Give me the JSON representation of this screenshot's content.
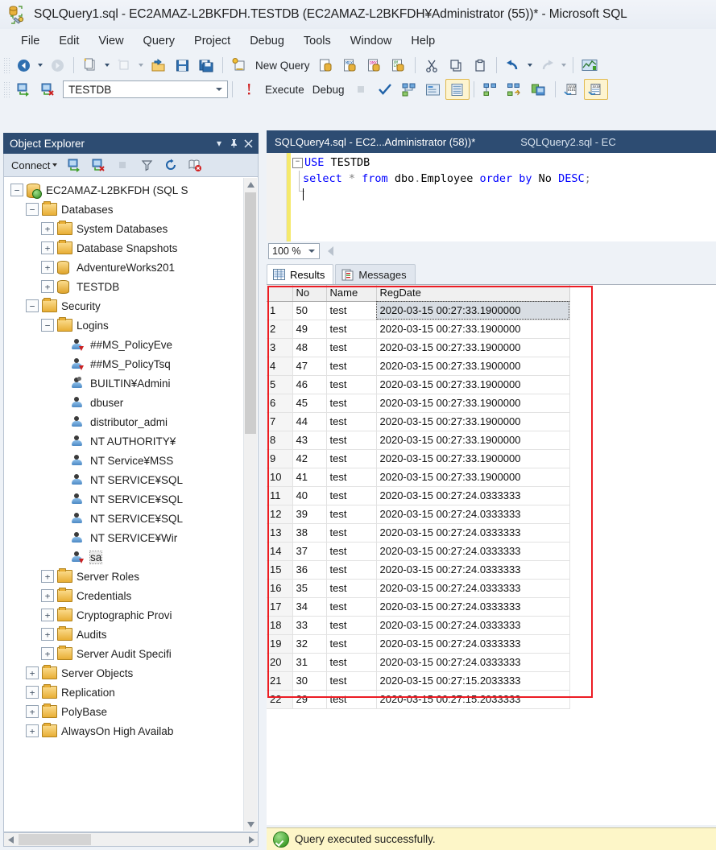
{
  "window": {
    "title": "SQLQuery1.sql - EC2AMAZ-L2BKFDH.TESTDB (EC2AMAZ-L2BKFDH¥Administrator (55))* - Microsoft SQL",
    "icon": "sql-query-file-icon"
  },
  "menu": {
    "items": [
      "File",
      "Edit",
      "View",
      "Query",
      "Project",
      "Debug",
      "Tools",
      "Window",
      "Help"
    ]
  },
  "toolbar_main": {
    "new_query_label": "New Query",
    "icons": [
      "navigate-back-icon",
      "navigate-forward-icon",
      "new-project-icon",
      "new-item-icon",
      "open-file-icon",
      "save-icon",
      "save-all-icon",
      "new-query-icon",
      "new-query-with-current-connection-icon",
      "new-analysis-services-mdx-query-icon",
      "new-analysis-services-dmx-query-icon",
      "new-analysis-services-xmla-query-icon",
      "cut-icon",
      "copy-icon",
      "paste-icon",
      "undo-icon",
      "redo-icon",
      "activity-monitor-icon"
    ]
  },
  "toolbar_query": {
    "database_value": "TESTDB",
    "execute_label": "Execute",
    "debug_label": "Debug",
    "icons": [
      "available-databases-icon",
      "change-connection-icon",
      "disconnect-icon",
      "execute-icon",
      "stop-icon",
      "parse-icon",
      "display-estimated-execution-plan-icon",
      "query-options-icon",
      "results-to-grid-icon",
      "include-actual-execution-plan-icon",
      "include-live-query-statistics-icon",
      "results-to-text-icon",
      "results-to-file-icon",
      "comment-icon",
      "uncomment-icon"
    ]
  },
  "object_explorer": {
    "title": "Object Explorer",
    "connect_label": "Connect",
    "header_icons": [
      "window-position-icon",
      "auto-hide-pin-icon",
      "close-icon"
    ],
    "toolbar_icons": [
      "connect-object-explorer-icon",
      "disconnect-object-explorer-icon",
      "stop-icon",
      "filter-icon",
      "refresh-icon",
      "script-error-icon"
    ],
    "tree": [
      {
        "label": "EC2AMAZ-L2BKFDH (SQL S",
        "indent": 0,
        "expander": "minus",
        "icon": "server-icon"
      },
      {
        "label": "Databases",
        "indent": 1,
        "expander": "minus",
        "icon": "folder-icon"
      },
      {
        "label": "System Databases",
        "indent": 2,
        "expander": "plus",
        "icon": "folder-icon"
      },
      {
        "label": "Database Snapshots",
        "indent": 2,
        "expander": "plus",
        "icon": "folder-icon"
      },
      {
        "label": "AdventureWorks201",
        "indent": 2,
        "expander": "plus",
        "icon": "database-icon"
      },
      {
        "label": "TESTDB",
        "indent": 2,
        "expander": "plus",
        "icon": "database-icon"
      },
      {
        "label": "Security",
        "indent": 1,
        "expander": "minus",
        "icon": "folder-icon"
      },
      {
        "label": "Logins",
        "indent": 2,
        "expander": "minus",
        "icon": "folder-icon"
      },
      {
        "label": "##MS_PolicyEve",
        "indent": 3,
        "expander": "none",
        "icon": "login-disabled-icon"
      },
      {
        "label": "##MS_PolicyTsq",
        "indent": 3,
        "expander": "none",
        "icon": "login-disabled-icon"
      },
      {
        "label": "BUILTIN¥Admini",
        "indent": 3,
        "expander": "none",
        "icon": "login-group-icon"
      },
      {
        "label": "dbuser",
        "indent": 3,
        "expander": "none",
        "icon": "login-icon"
      },
      {
        "label": "distributor_admi",
        "indent": 3,
        "expander": "none",
        "icon": "login-icon"
      },
      {
        "label": "NT AUTHORITY¥",
        "indent": 3,
        "expander": "none",
        "icon": "login-icon"
      },
      {
        "label": "NT Service¥MSS",
        "indent": 3,
        "expander": "none",
        "icon": "login-icon"
      },
      {
        "label": "NT SERVICE¥SQL",
        "indent": 3,
        "expander": "none",
        "icon": "login-icon"
      },
      {
        "label": "NT SERVICE¥SQL",
        "indent": 3,
        "expander": "none",
        "icon": "login-icon"
      },
      {
        "label": "NT SERVICE¥SQL",
        "indent": 3,
        "expander": "none",
        "icon": "login-icon"
      },
      {
        "label": "NT SERVICE¥Wir",
        "indent": 3,
        "expander": "none",
        "icon": "login-icon"
      },
      {
        "label": "sa",
        "indent": 3,
        "expander": "none",
        "icon": "login-disabled-icon",
        "selected": true
      },
      {
        "label": "Server Roles",
        "indent": 2,
        "expander": "plus",
        "icon": "folder-icon"
      },
      {
        "label": "Credentials",
        "indent": 2,
        "expander": "plus",
        "icon": "folder-icon"
      },
      {
        "label": "Cryptographic Provi",
        "indent": 2,
        "expander": "plus",
        "icon": "folder-icon"
      },
      {
        "label": "Audits",
        "indent": 2,
        "expander": "plus",
        "icon": "folder-icon"
      },
      {
        "label": "Server Audit Specifi",
        "indent": 2,
        "expander": "plus",
        "icon": "folder-icon"
      },
      {
        "label": "Server Objects",
        "indent": 1,
        "expander": "plus",
        "icon": "folder-icon"
      },
      {
        "label": "Replication",
        "indent": 1,
        "expander": "plus",
        "icon": "folder-icon"
      },
      {
        "label": "PolyBase",
        "indent": 1,
        "expander": "plus",
        "icon": "folder-icon"
      },
      {
        "label": "AlwaysOn High Availab",
        "indent": 1,
        "expander": "plus",
        "icon": "folder-icon"
      }
    ]
  },
  "document_tabs": [
    {
      "label": "SQLQuery4.sql - EC2...Administrator (58))*",
      "active": true
    },
    {
      "label": "SQLQuery2.sql - EC",
      "active": false
    }
  ],
  "editor": {
    "zoom": "100 %",
    "lines": [
      {
        "fold": true,
        "tokens": [
          {
            "t": "USE ",
            "c": "kw"
          },
          {
            "t": "TESTDB",
            "c": "id"
          }
        ]
      },
      {
        "fold": false,
        "tokens": [
          {
            "t": "select ",
            "c": "kw"
          },
          {
            "t": "* ",
            "c": "op"
          },
          {
            "t": "from ",
            "c": "kw"
          },
          {
            "t": "dbo",
            "c": "id"
          },
          {
            "t": ".",
            "c": "op"
          },
          {
            "t": "Employee ",
            "c": "id"
          },
          {
            "t": "order ",
            "c": "kw"
          },
          {
            "t": "by ",
            "c": "kw"
          },
          {
            "t": "No ",
            "c": "id"
          },
          {
            "t": "DESC",
            "c": "kw"
          },
          {
            "t": ";",
            "c": "op"
          }
        ]
      }
    ]
  },
  "result_tabs": [
    {
      "label": "Results",
      "icon": "grid-icon",
      "active": true
    },
    {
      "label": "Messages",
      "icon": "messages-icon",
      "active": false
    }
  ],
  "results_grid": {
    "columns": [
      "",
      "No",
      "Name",
      "RegDate"
    ],
    "selected_cell": {
      "row": 1,
      "column": "RegDate"
    },
    "rows": [
      [
        "1",
        "50",
        "test",
        "2020-03-15 00:27:33.1900000"
      ],
      [
        "2",
        "49",
        "test",
        "2020-03-15 00:27:33.1900000"
      ],
      [
        "3",
        "48",
        "test",
        "2020-03-15 00:27:33.1900000"
      ],
      [
        "4",
        "47",
        "test",
        "2020-03-15 00:27:33.1900000"
      ],
      [
        "5",
        "46",
        "test",
        "2020-03-15 00:27:33.1900000"
      ],
      [
        "6",
        "45",
        "test",
        "2020-03-15 00:27:33.1900000"
      ],
      [
        "7",
        "44",
        "test",
        "2020-03-15 00:27:33.1900000"
      ],
      [
        "8",
        "43",
        "test",
        "2020-03-15 00:27:33.1900000"
      ],
      [
        "9",
        "42",
        "test",
        "2020-03-15 00:27:33.1900000"
      ],
      [
        "10",
        "41",
        "test",
        "2020-03-15 00:27:33.1900000"
      ],
      [
        "11",
        "40",
        "test",
        "2020-03-15 00:27:24.0333333"
      ],
      [
        "12",
        "39",
        "test",
        "2020-03-15 00:27:24.0333333"
      ],
      [
        "13",
        "38",
        "test",
        "2020-03-15 00:27:24.0333333"
      ],
      [
        "14",
        "37",
        "test",
        "2020-03-15 00:27:24.0333333"
      ],
      [
        "15",
        "36",
        "test",
        "2020-03-15 00:27:24.0333333"
      ],
      [
        "16",
        "35",
        "test",
        "2020-03-15 00:27:24.0333333"
      ],
      [
        "17",
        "34",
        "test",
        "2020-03-15 00:27:24.0333333"
      ],
      [
        "18",
        "33",
        "test",
        "2020-03-15 00:27:24.0333333"
      ],
      [
        "19",
        "32",
        "test",
        "2020-03-15 00:27:24.0333333"
      ],
      [
        "20",
        "31",
        "test",
        "2020-03-15 00:27:24.0333333"
      ],
      [
        "21",
        "30",
        "test",
        "2020-03-15 00:27:15.2033333"
      ],
      [
        "22",
        "29",
        "test",
        "2020-03-15 00:27:15.2033333"
      ]
    ]
  },
  "annotation": {
    "type": "red-rectangle",
    "covers": "header row through result row 17",
    "color": "#ec1c24"
  },
  "status": {
    "message": "Query executed successfully.",
    "icon": "success-check-icon"
  },
  "colors": {
    "accent_dark_blue": "#2d4c72",
    "chrome": "#eef2f7",
    "status_bar": "#fdf6c8",
    "annotation_red": "#ec1c24",
    "sql_keyword": "#0000ff"
  }
}
